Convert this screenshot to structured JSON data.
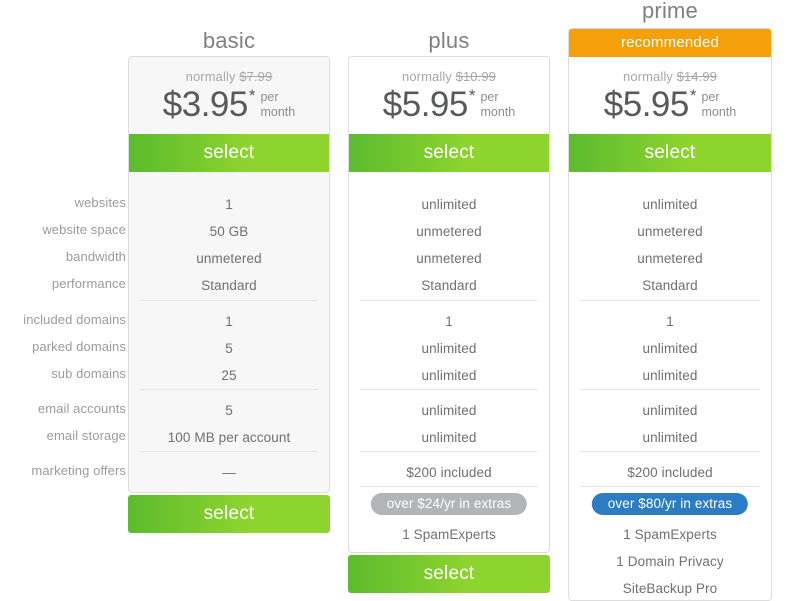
{
  "colors": {
    "green_start": "#5cbb2e",
    "green_end": "#8ed42e",
    "orange": "#f5a00a",
    "blue": "#2b7cc4",
    "grey_pill": "#b3b4b6",
    "text": "#6d6e71",
    "card_border": "#dcdddf",
    "basic_card_bg": "#f7f7f7"
  },
  "feature_labels": [
    "websites",
    "website space",
    "bandwidth",
    "performance",
    "included domains",
    "parked domains",
    "sub domains",
    "email accounts",
    "email storage",
    "marketing offers"
  ],
  "plans": [
    {
      "name": "basic",
      "recommended_label": "",
      "normally_prefix": "normally",
      "normally_price": "$7.99",
      "price": "$3.95",
      "price_star": "*",
      "per": "per",
      "month": "month",
      "select_label": "select",
      "bottom_select_label": "select",
      "features": [
        "1",
        "50 GB",
        "unmetered",
        "Standard",
        "1",
        "5",
        "25",
        "5",
        "100 MB per account",
        "—"
      ],
      "extras_badge": "",
      "extras": []
    },
    {
      "name": "plus",
      "recommended_label": "",
      "normally_prefix": "normally",
      "normally_price": "$10.99",
      "price": "$5.95",
      "price_star": "*",
      "per": "per",
      "month": "month",
      "select_label": "select",
      "bottom_select_label": "select",
      "features": [
        "unlimited",
        "unmetered",
        "unmetered",
        "Standard",
        "1",
        "unlimited",
        "unlimited",
        "unlimited",
        "unlimited",
        "$200 included"
      ],
      "extras_badge": "over $24/yr in extras",
      "extras": [
        "1 SpamExperts"
      ]
    },
    {
      "name": "prime",
      "recommended_label": "recommended",
      "normally_prefix": "normally",
      "normally_price": "$14.99",
      "price": "$5.95",
      "price_star": "*",
      "per": "per",
      "month": "month",
      "select_label": "select",
      "bottom_select_label": "",
      "features": [
        "unlimited",
        "unmetered",
        "unmetered",
        "Standard",
        "1",
        "unlimited",
        "unlimited",
        "unlimited",
        "unlimited",
        "$200 included"
      ],
      "extras_badge": "over $80/yr in extras",
      "extras": [
        "1 SpamExperts",
        "1 Domain Privacy",
        "SiteBackup Pro"
      ]
    }
  ]
}
